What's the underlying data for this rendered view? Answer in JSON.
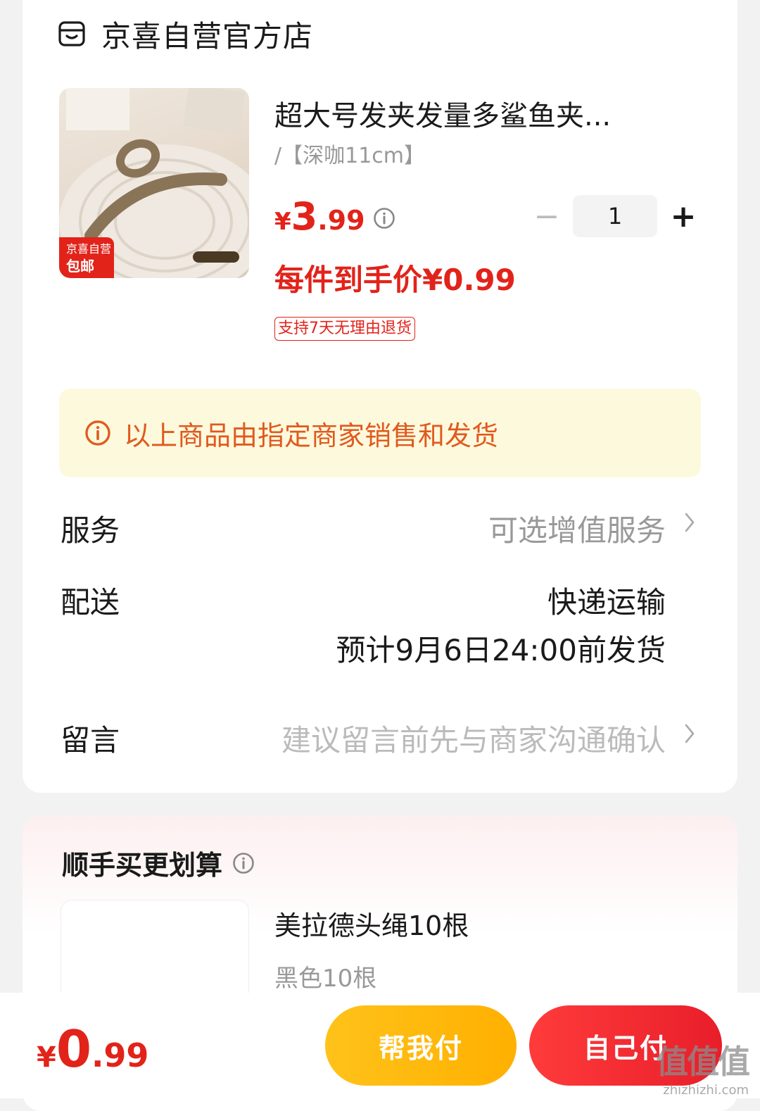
{
  "store": {
    "name": "京喜自营官方店",
    "icon": "store-icon"
  },
  "product": {
    "title": "超大号发夹发量多鲨鱼夹...",
    "spec": "/【深咖11cm】",
    "price": {
      "currency": "¥",
      "integer": "3",
      "decimal": ".99"
    },
    "quantity": "1",
    "minus": "−",
    "plus": "+",
    "unit_price": "每件到手价¥0.99",
    "return_policy": "支持7天无理由退货",
    "image_badge": {
      "line1": "京喜自营",
      "line2": "包邮"
    }
  },
  "notice": {
    "text": "以上商品由指定商家销售和发货"
  },
  "rows": {
    "service": {
      "label": "服务",
      "value": "可选增值服务"
    },
    "delivery": {
      "label": "配送",
      "method": "快递运输",
      "eta": "预计9月6日24:00前发货"
    },
    "message": {
      "label": "留言",
      "placeholder": "建议留言前先与商家沟通确认"
    }
  },
  "addon": {
    "title": "顺手买更划算",
    "item": {
      "name": "美拉德头绳10根",
      "spec": "黑色10根"
    }
  },
  "footer": {
    "total": {
      "currency": "¥",
      "integer": "0",
      "decimal": ".99"
    },
    "help_pay": "帮我付",
    "self_pay": "自己付"
  },
  "watermark": {
    "logo": "值值值",
    "url": "zhizhizhi.com"
  },
  "colors": {
    "accent_red": "#e2231a",
    "notice_bg": "#fdf9dd",
    "notice_text": "#e05a1e",
    "help_btn": "#ffb800",
    "self_btn": "#f02b2b"
  }
}
